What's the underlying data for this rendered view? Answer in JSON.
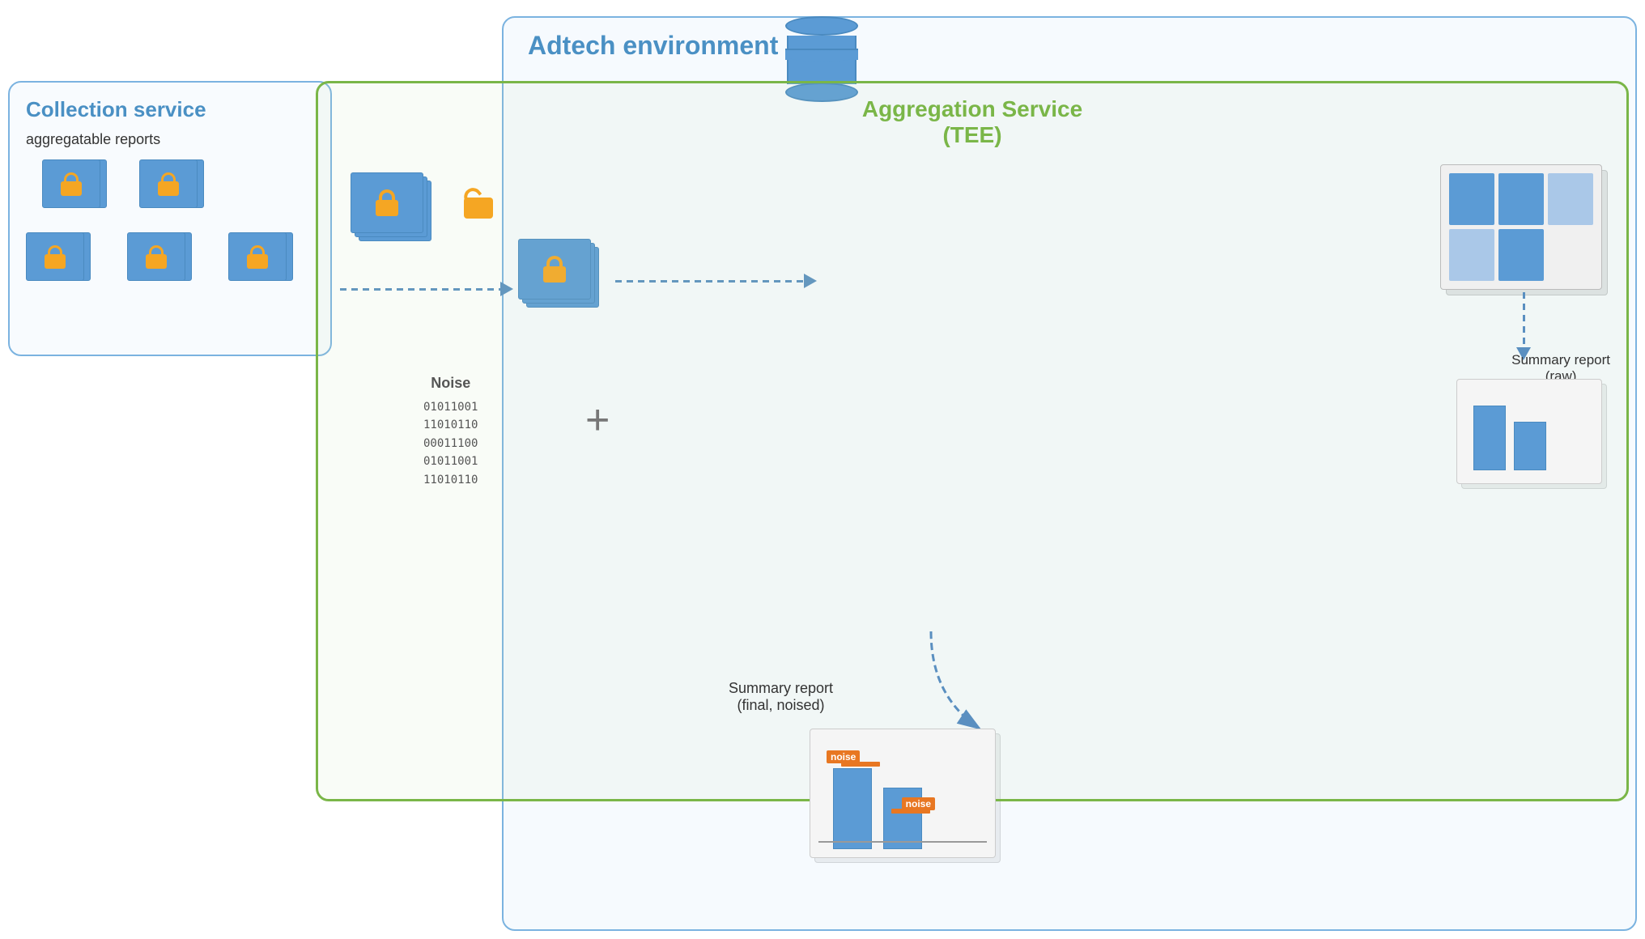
{
  "adtech": {
    "title": "Adtech environment"
  },
  "collection": {
    "title": "Collection service",
    "subtitle": "aggregatable reports"
  },
  "aggregation": {
    "title": "Aggregation Service",
    "subtitle": "(TEE)"
  },
  "noise": {
    "label": "Noise",
    "binary": [
      "01011001",
      "11010110",
      "00011100",
      "01011001",
      "11010110"
    ]
  },
  "summary_raw": {
    "label": "Summary report",
    "sublabel": "(raw)"
  },
  "summary_final": {
    "label": "Summary report",
    "sublabel": "(final, noised)"
  },
  "noise_tag1": "noise",
  "noise_tag2": "noise",
  "plus_sign": "+"
}
